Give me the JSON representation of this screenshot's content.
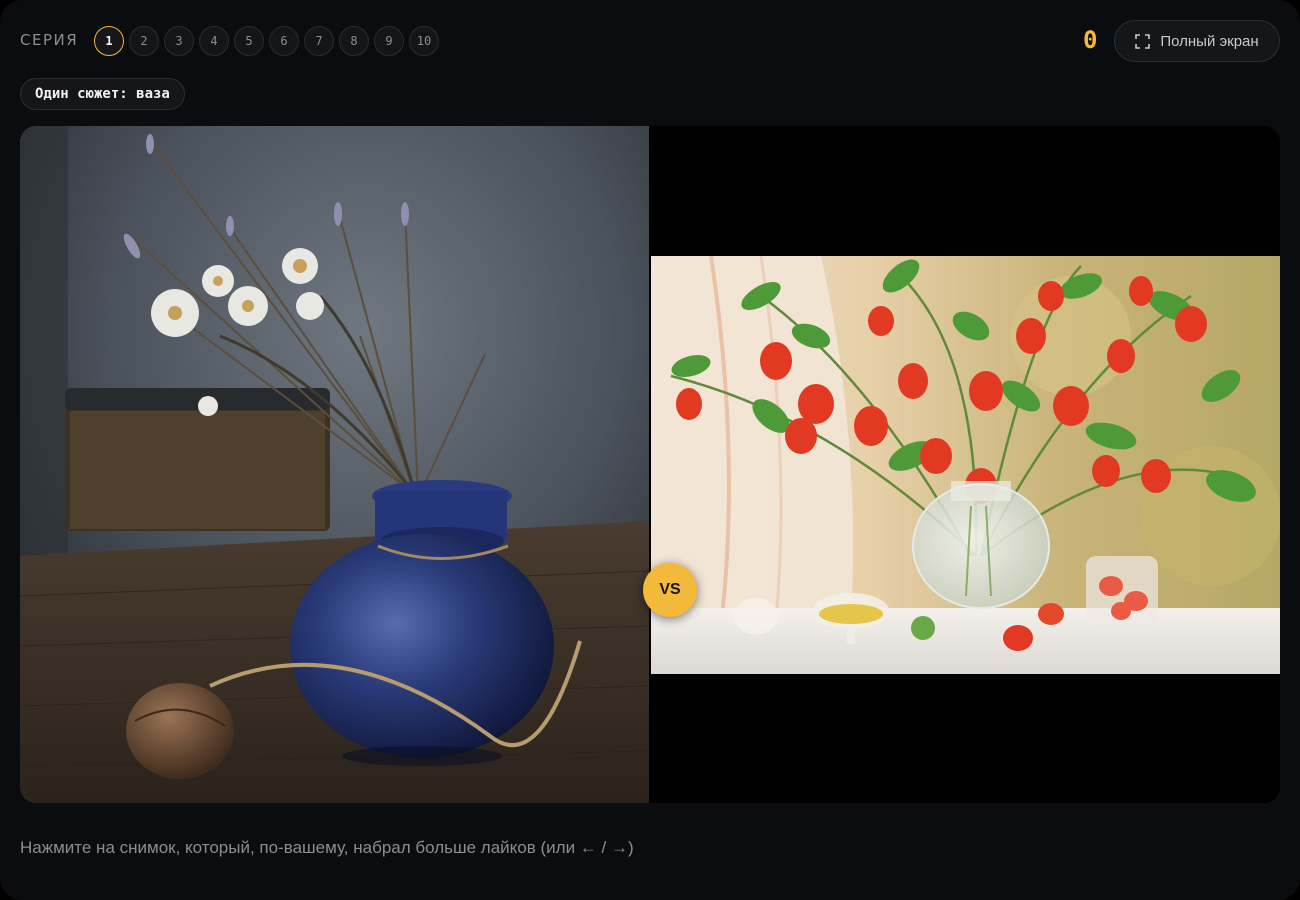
{
  "header": {
    "series_label": "СЕРИЯ",
    "rounds": [
      {
        "label": "1",
        "active": true
      },
      {
        "label": "2",
        "active": false
      },
      {
        "label": "3",
        "active": false
      },
      {
        "label": "4",
        "active": false
      },
      {
        "label": "5",
        "active": false
      },
      {
        "label": "6",
        "active": false
      },
      {
        "label": "7",
        "active": false
      },
      {
        "label": "8",
        "active": false
      },
      {
        "label": "9",
        "active": false
      },
      {
        "label": "10",
        "active": false
      }
    ],
    "score": "0",
    "fullscreen_label": "Полный экран",
    "fullscreen_icon": "fullscreen-corners-icon"
  },
  "subject_tag": "Один сюжет: ваза",
  "comparison": {
    "left_photo": "blue-vase-dried-flowers-walnut",
    "right_photo": "glass-vase-physalis-window",
    "vs_label": "VS"
  },
  "hint": "Нажмите на снимок, который, по-вашему, набрал больше лайков (или ← / →)",
  "colors": {
    "accent": "#f2b93b",
    "background": "#0b0c0f",
    "muted_text": "#8b8d93"
  }
}
